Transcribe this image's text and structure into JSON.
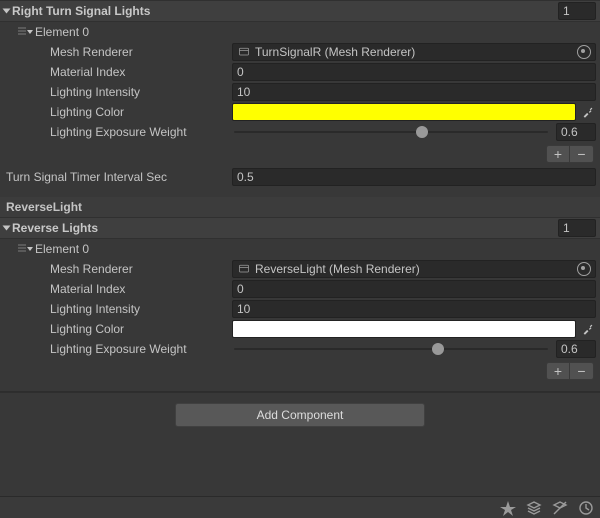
{
  "sections": {
    "rightTurn": {
      "title": "Right Turn Signal Lights",
      "arraySize": "1",
      "element": {
        "label": "Element 0",
        "meshRenderer": {
          "label": "Mesh Renderer",
          "value": "TurnSignalR (Mesh Renderer)"
        },
        "materialIndex": {
          "label": "Material Index",
          "value": "0"
        },
        "lightingIntensity": {
          "label": "Lighting Intensity",
          "value": "10"
        },
        "lightingColor": {
          "label": "Lighting Color",
          "hex": "#ffff00"
        },
        "lightingExposureWeight": {
          "label": "Lighting Exposure Weight",
          "value": "0.6",
          "sliderPct": 60
        }
      }
    },
    "timer": {
      "label": "Turn Signal Timer Interval Sec",
      "value": "0.5"
    },
    "reverseHeader": "ReverseLight",
    "reverse": {
      "title": "Reverse Lights",
      "arraySize": "1",
      "element": {
        "label": "Element 0",
        "meshRenderer": {
          "label": "Mesh Renderer",
          "value": "ReverseLight (Mesh Renderer)"
        },
        "materialIndex": {
          "label": "Material Index",
          "value": "0"
        },
        "lightingIntensity": {
          "label": "Lighting Intensity",
          "value": "10"
        },
        "lightingColor": {
          "label": "Lighting Color",
          "hex": "#ffffff"
        },
        "lightingExposureWeight": {
          "label": "Lighting Exposure Weight",
          "value": "0.6",
          "sliderPct": 65
        }
      }
    }
  },
  "buttons": {
    "plus": "+",
    "minus": "−",
    "addComponent": "Add Component"
  }
}
